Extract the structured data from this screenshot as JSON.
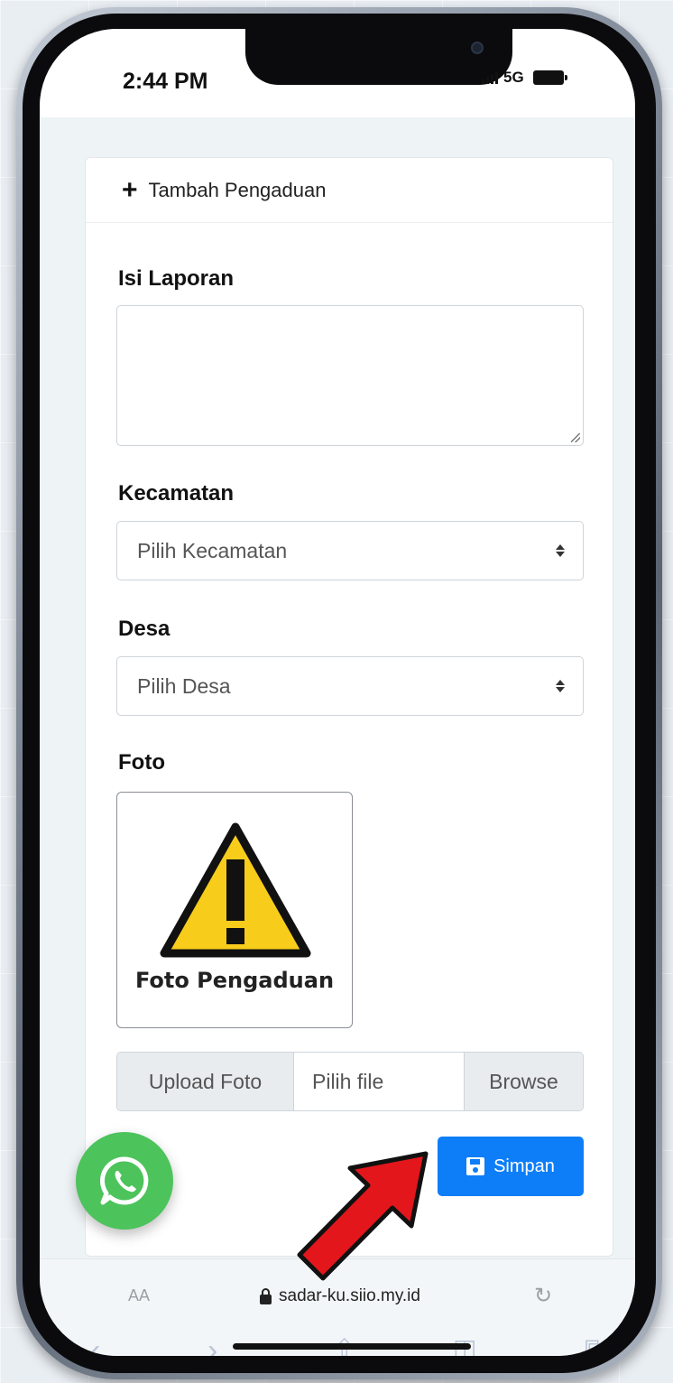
{
  "status_bar": {
    "time": "2:44 PM",
    "network": "5G"
  },
  "header": {
    "title": "Tambah Pengaduan"
  },
  "form": {
    "report_label": "Isi Laporan",
    "report_value": "",
    "district_label": "Kecamatan",
    "district_selected": "Pilih Kecamatan",
    "village_label": "Desa",
    "village_selected": "Pilih Desa",
    "photo_label": "Foto",
    "photo_placeholder_caption": "Foto Pengaduan",
    "upload_label": "Upload Foto",
    "file_placeholder": "Pilih file",
    "browse_label": "Browse",
    "save_label": "Simpan"
  },
  "browser": {
    "aa_label": "AA",
    "url": "sadar-ku.siio.my.id"
  },
  "colors": {
    "primary": "#0d7ef7",
    "whatsapp": "#4cc35b",
    "warning": "#f8cc1b",
    "arrow": "#e3161c"
  },
  "icons": [
    "plus-icon",
    "resize-icon",
    "sort-arrow-icon",
    "warning-icon",
    "floppy-disk-icon",
    "whatsapp-icon",
    "lock-icon",
    "reload-icon",
    "red-arrow-annotation"
  ]
}
